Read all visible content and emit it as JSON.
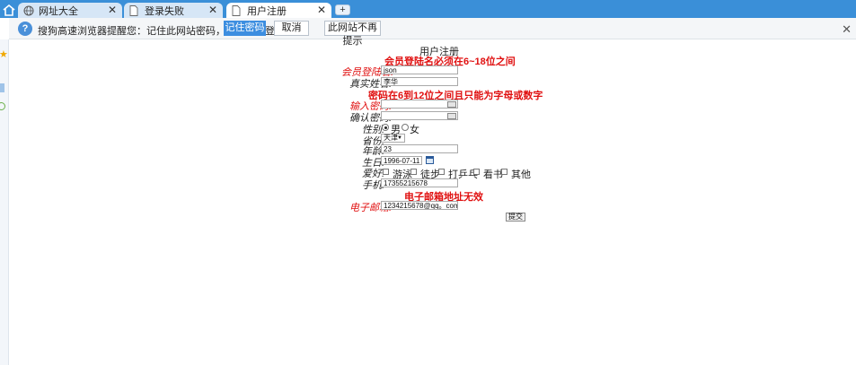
{
  "tabs": [
    {
      "label": "网址大全",
      "icon": "globe-icon",
      "active": false
    },
    {
      "label": "登录失败",
      "icon": "page-icon",
      "active": false
    },
    {
      "label": "用户注册",
      "icon": "page-icon",
      "active": true
    }
  ],
  "notice": {
    "text": "搜狗高速浏览器提醒您：记住此网站密码，下次一键登录！",
    "remember_label": "记住密码",
    "cancel_label": "取消",
    "never_label": "此网站不再提示"
  },
  "form": {
    "title": "用户注册",
    "error_username": "会员登陆名必须在6~18位之间",
    "error_password": "密码在6到12位之间且只能为字母或数字",
    "error_email": "电子邮箱地址无效",
    "labels": {
      "username": "会员登陆名:",
      "realname": "真实姓名:",
      "password": "输入密码:",
      "confirm": "确认密码:",
      "gender": "性别:",
      "province": "省份:",
      "age": "年龄:",
      "birthday": "生日:",
      "hobby": "爱好:",
      "phone": "手机:",
      "email": "电子邮箱:"
    },
    "values": {
      "username": "json",
      "realname": "李华",
      "password": "",
      "confirm": "",
      "province": "天津",
      "age": "23",
      "birthday": "1996-07-11",
      "phone": "17355215678",
      "email": "1234215678@qq。com"
    },
    "gender_options": [
      "男",
      "女"
    ],
    "gender_selected": "男",
    "hobbies": [
      "游泳",
      "徒步",
      "打乒乓",
      "看书",
      "其他"
    ],
    "submit_label": "提交"
  }
}
